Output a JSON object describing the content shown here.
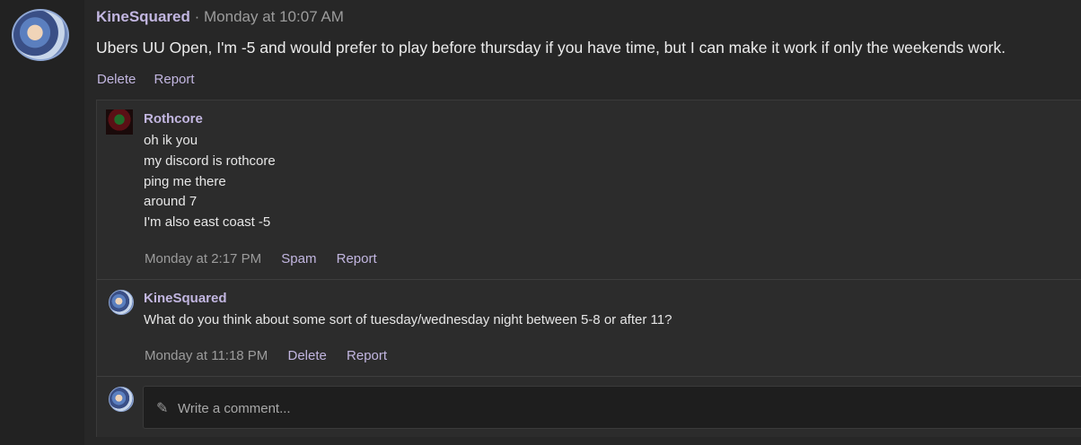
{
  "post": {
    "author": "KineSquared",
    "separator": "·",
    "timestamp": "Monday at 10:07 AM",
    "body": "Ubers UU Open, I'm -5 and would prefer to play before thursday if you have time, but I can make it work if only the weekends work.",
    "actions": {
      "delete": "Delete",
      "report": "Report"
    }
  },
  "comments": [
    {
      "author": "Rothcore",
      "lines": [
        "oh ik you",
        "my discord is rothcore",
        "ping me there",
        "around 7",
        "I'm also east coast -5"
      ],
      "timestamp": "Monday at 2:17 PM",
      "actions": [
        "Spam",
        "Report"
      ]
    },
    {
      "author": "KineSquared",
      "lines": [
        "What do you think about some sort of tuesday/wednesday night between 5-8 or after 11?"
      ],
      "timestamp": "Monday at 11:18 PM",
      "actions": [
        "Delete",
        "Report"
      ]
    }
  ],
  "compose": {
    "placeholder": "Write a comment...",
    "icon": "pencil-icon"
  },
  "colors": {
    "username": "#c2b6e0",
    "background": "#272727",
    "muted": "#9c9c9c"
  }
}
